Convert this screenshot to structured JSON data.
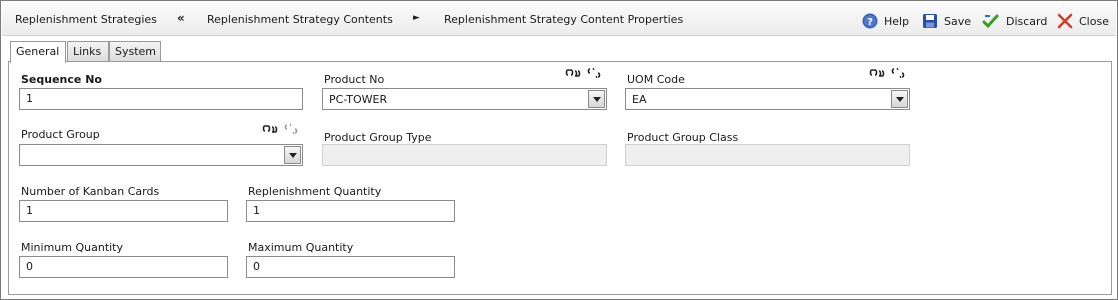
{
  "breadcrumb": {
    "item1": "Replenishment Strategies",
    "sep1": "«",
    "item2": "Replenishment Strategy Contents",
    "sep2": "►",
    "item3": "Replenishment Strategy Content Properties"
  },
  "actions": {
    "help": "Help",
    "save": "Save",
    "discard": "Discard",
    "close": "Close"
  },
  "tabs": [
    "General",
    "Links",
    "System"
  ],
  "form": {
    "sequence_no": {
      "label": "Sequence No",
      "value": "1"
    },
    "product_no": {
      "label": "Product No",
      "value": "PC-TOWER"
    },
    "uom_code": {
      "label": "UOM Code",
      "value": "EA"
    },
    "product_group": {
      "label": "Product Group",
      "value": ""
    },
    "product_group_type": {
      "label": "Product Group Type",
      "value": ""
    },
    "product_group_class": {
      "label": "Product Group Class",
      "value": ""
    },
    "kanban_cards": {
      "label": "Number of Kanban Cards",
      "value": "1"
    },
    "replenishment_qty": {
      "label": "Replenishment Quantity",
      "value": "1"
    },
    "minimum_qty": {
      "label": "Minimum Quantity",
      "value": "0"
    },
    "maximum_qty": {
      "label": "Maximum Quantity",
      "value": "0"
    }
  },
  "icons": {
    "help": "help-circle-icon",
    "save": "floppy-disk-icon",
    "discard": "discard-check-icon",
    "close": "close-x-icon",
    "link": "link-icon",
    "unlink": "unlink-icon"
  },
  "colors": {
    "help_blue": "#3a5fb8",
    "save_blue": "#2a4fa8",
    "discard_green": "#3a9a2a",
    "close_red": "#d23a2a"
  }
}
